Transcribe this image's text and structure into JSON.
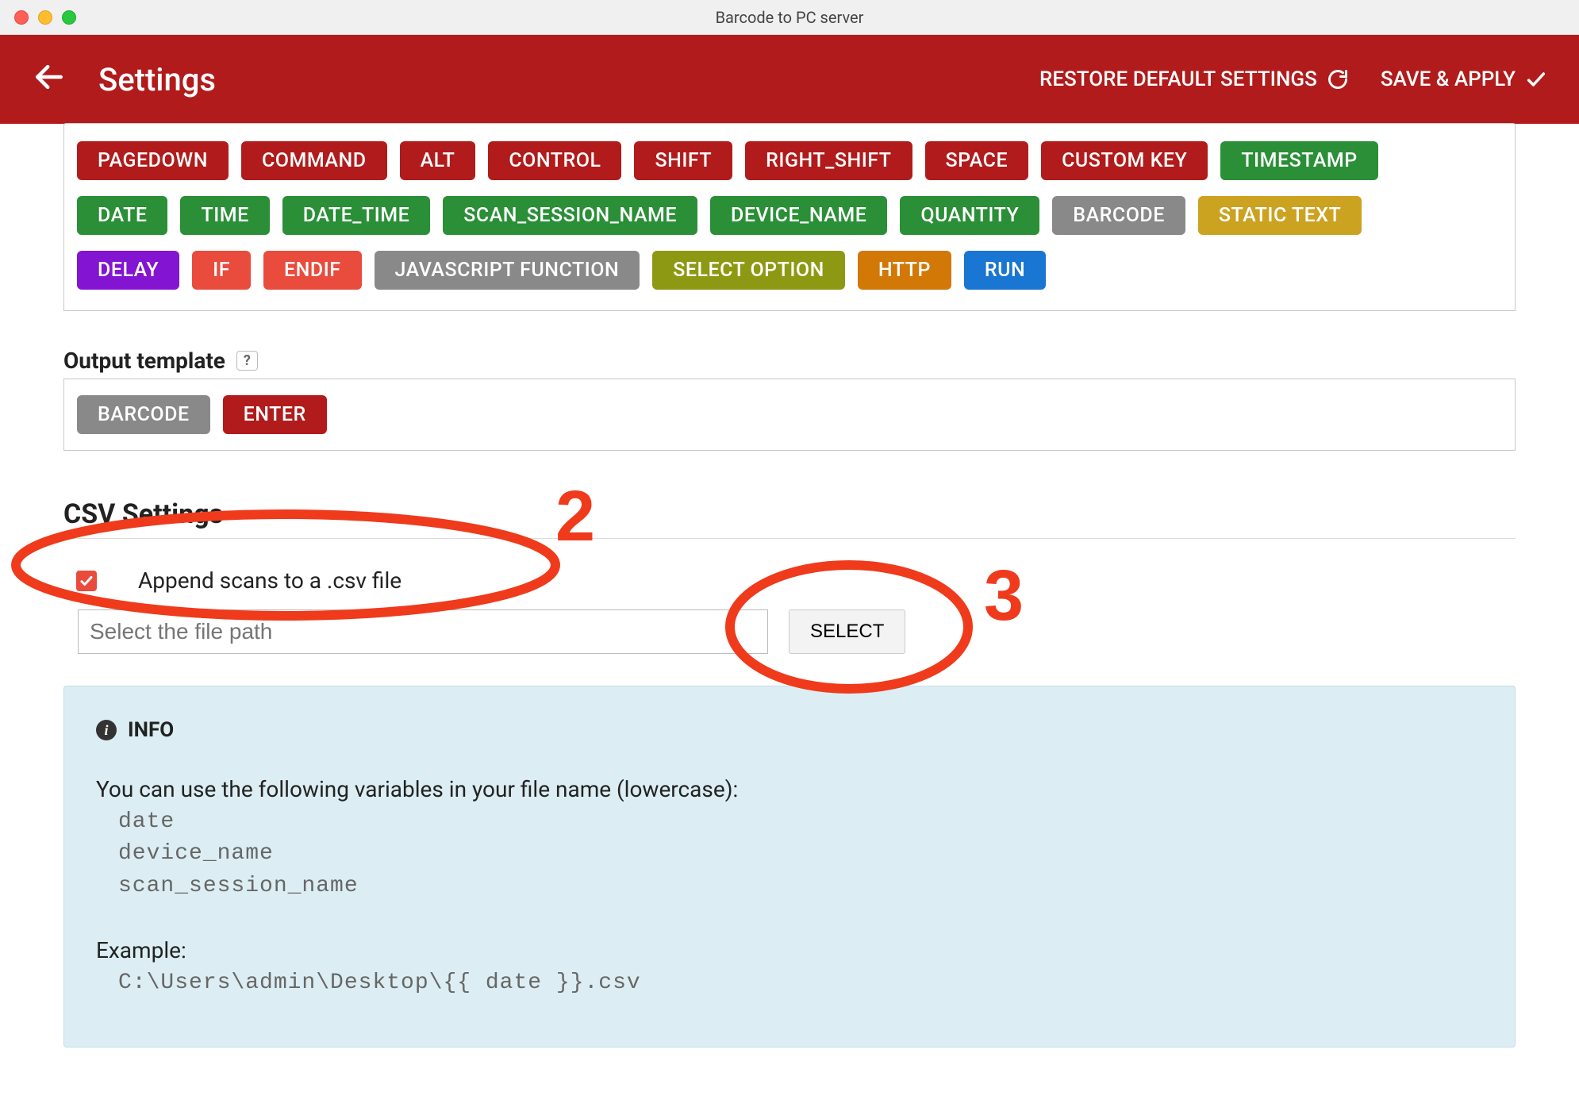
{
  "window": {
    "title": "Barcode to PC server"
  },
  "header": {
    "title": "Settings",
    "restore_label": "RESTORE DEFAULT SETTINGS",
    "save_label": "SAVE & APPLY"
  },
  "chips_row1": [
    {
      "label": "PAGEDOWN",
      "cls": "c-red"
    },
    {
      "label": "COMMAND",
      "cls": "c-red"
    },
    {
      "label": "ALT",
      "cls": "c-red"
    },
    {
      "label": "CONTROL",
      "cls": "c-red"
    },
    {
      "label": "SHIFT",
      "cls": "c-red"
    },
    {
      "label": "RIGHT_SHIFT",
      "cls": "c-red"
    },
    {
      "label": "SPACE",
      "cls": "c-red"
    },
    {
      "label": "CUSTOM KEY",
      "cls": "c-red"
    },
    {
      "label": "TIMESTAMP",
      "cls": "c-green"
    }
  ],
  "chips_row2": [
    {
      "label": "DATE",
      "cls": "c-green"
    },
    {
      "label": "TIME",
      "cls": "c-green"
    },
    {
      "label": "DATE_TIME",
      "cls": "c-green"
    },
    {
      "label": "SCAN_SESSION_NAME",
      "cls": "c-green"
    },
    {
      "label": "DEVICE_NAME",
      "cls": "c-green"
    },
    {
      "label": "QUANTITY",
      "cls": "c-green"
    },
    {
      "label": "BARCODE",
      "cls": "c-grey"
    },
    {
      "label": "STATIC TEXT",
      "cls": "c-yellow"
    }
  ],
  "chips_row3": [
    {
      "label": "DELAY",
      "cls": "c-purple"
    },
    {
      "label": "IF",
      "cls": "c-lred"
    },
    {
      "label": "ENDIF",
      "cls": "c-lred"
    },
    {
      "label": "JAVASCRIPT FUNCTION",
      "cls": "c-grey"
    },
    {
      "label": "SELECT OPTION",
      "cls": "c-olive"
    },
    {
      "label": "HTTP",
      "cls": "c-amber"
    },
    {
      "label": "RUN",
      "cls": "c-blue"
    }
  ],
  "output_template": {
    "label": "Output template",
    "help": "?",
    "chips": [
      {
        "label": "BARCODE",
        "cls": "c-grey"
      },
      {
        "label": "ENTER",
        "cls": "c-red"
      }
    ]
  },
  "csv": {
    "title": "CSV Settings",
    "append_label": "Append scans to a .csv file",
    "path_placeholder": "Select the file path",
    "select_label": "SELECT"
  },
  "info": {
    "head": "INFO",
    "lead": "You can use the following variables in your file name (lowercase):",
    "vars": [
      "date",
      "device_name",
      "scan_session_name"
    ],
    "example_label": "Example:",
    "example_path": "C:\\Users\\admin\\Desktop\\{{ date }}.csv"
  },
  "annotations": {
    "two": "2",
    "three": "3"
  }
}
